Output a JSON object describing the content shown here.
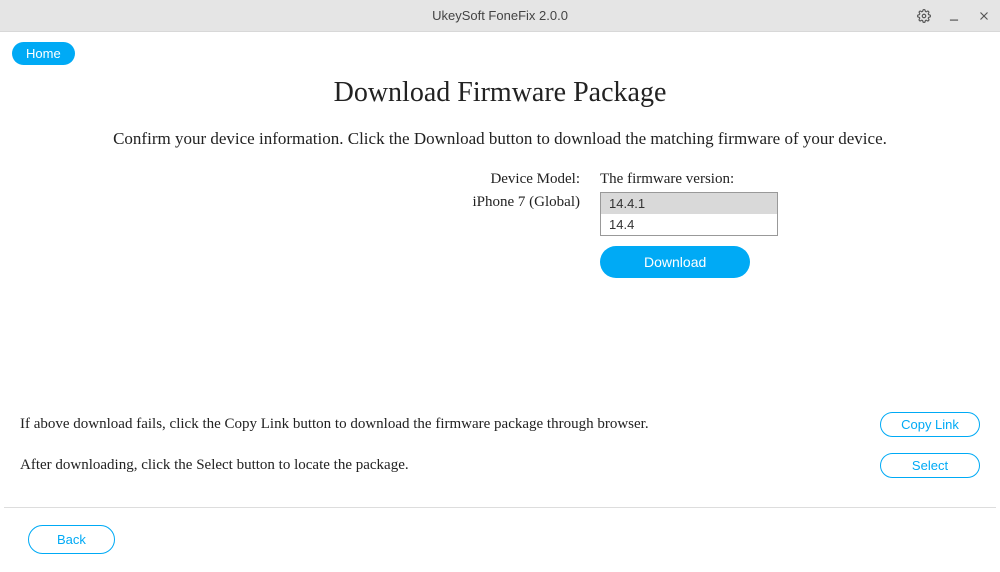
{
  "titlebar": {
    "title": "UkeySoft FoneFix 2.0.0"
  },
  "nav": {
    "home_label": "Home"
  },
  "main": {
    "heading": "Download Firmware Package",
    "subheading": "Confirm your device information. Click the Download button to download the matching firmware of your device.",
    "device_model_label": "Device Model:",
    "device_model_value": "iPhone 7 (Global)",
    "firmware_label": "The firmware version:",
    "firmware_options": [
      "14.4.1",
      "14.4"
    ],
    "firmware_selected": "14.4.1",
    "download_label": "Download"
  },
  "footer": {
    "hint1": "If above download fails, click the Copy Link button to download the firmware package through browser.",
    "hint2": "After downloading, click the Select button to locate the package.",
    "copy_link_label": "Copy Link",
    "select_label": "Select",
    "back_label": "Back"
  }
}
